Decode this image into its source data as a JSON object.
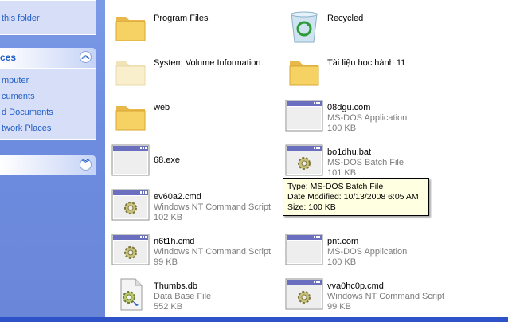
{
  "task_pane": {
    "folder_link": "this folder",
    "places_title": "ces",
    "places_items": [
      "mputer",
      "cuments",
      "d Documents",
      "twork Places"
    ],
    "collapse_glyph": "︽",
    "expand_glyph": "︾"
  },
  "files": [
    {
      "icon": "folder-icon",
      "name": "Program Files"
    },
    {
      "icon": "recycle-bin-icon",
      "name": "Recycled"
    },
    {
      "icon": "folder-faded-icon",
      "name": "System Volume Information"
    },
    {
      "icon": "folder-icon",
      "name": "Tài liệu học hành 11"
    },
    {
      "icon": "folder-icon",
      "name": "web"
    },
    {
      "icon": "dos-window-icon",
      "name": "08dgu.com",
      "type": "MS-DOS Application",
      "size": "100 KB"
    },
    {
      "icon": "dos-window-icon",
      "name": "68.exe"
    },
    {
      "icon": "batch-gear-icon",
      "name": "bo1dhu.bat",
      "type": "MS-DOS Batch File",
      "size": "101 KB"
    },
    {
      "icon": "batch-gear-icon",
      "name": "ev60a2.cmd",
      "type": "Windows NT Command Script",
      "size": "102 KB"
    },
    {
      "icon": "batch-gear-icon",
      "name": "n6t1h.cmd",
      "type": "Windows NT Command Script",
      "size": "99 KB"
    },
    {
      "icon": "dos-window-icon",
      "name": "pnt.com",
      "type": "MS-DOS Application",
      "size": "100 KB"
    },
    {
      "icon": "database-file-icon",
      "name": "Thumbs.db",
      "type": "Data Base File",
      "size": "552 KB"
    },
    {
      "icon": "batch-gear-icon",
      "name": "vva0hc0p.cmd",
      "type": "Windows NT Command Script",
      "size": "99 KB"
    }
  ],
  "tooltip": {
    "type_line": "Type: MS-DOS Batch File",
    "modified_line": "Date Modified: 10/13/2008 6:05 AM",
    "size_line": "Size: 100 KB"
  },
  "colors": {
    "task_pane_bg": "#6e8de0",
    "link": "#215dc6",
    "tooltip_bg": "#ffffe1",
    "folder": "#f6d164"
  }
}
